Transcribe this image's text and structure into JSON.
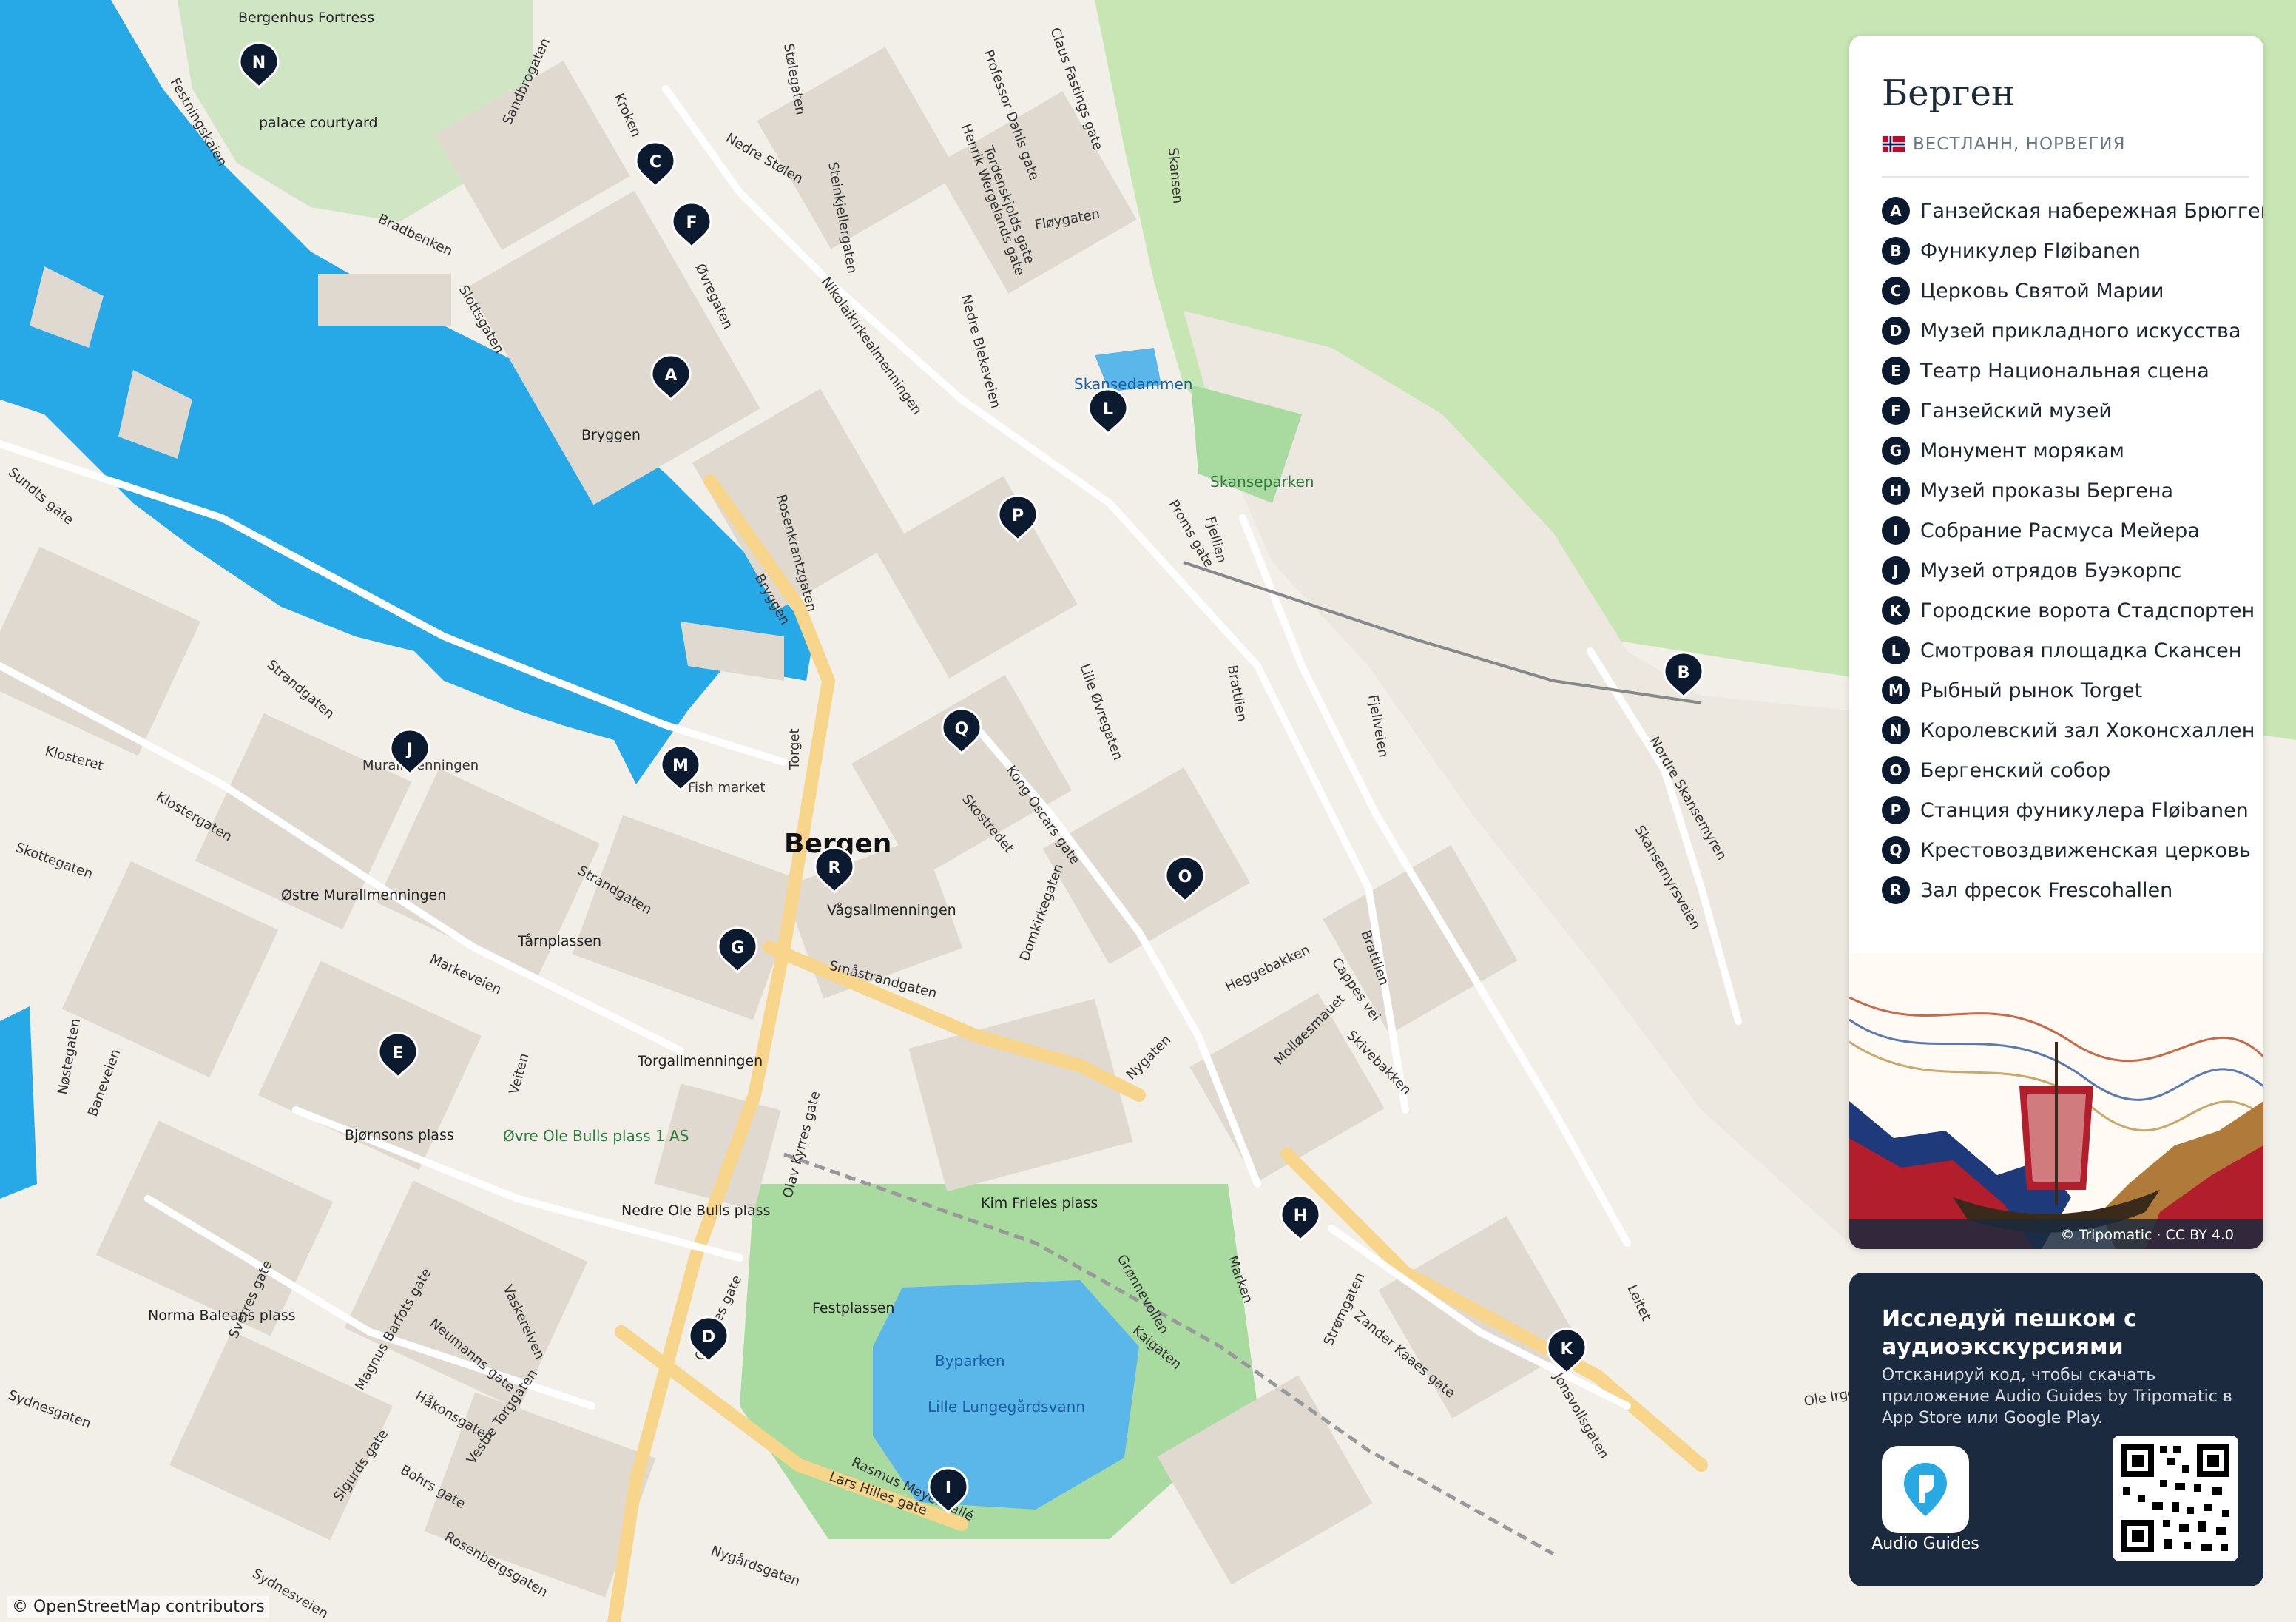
{
  "map": {
    "colors": {
      "water": "#27a9e8",
      "land": "#f2efe9",
      "block": "#e0d9cf",
      "green": "#c8e6b4",
      "park_dark": "#a9dba0",
      "road_main": "#f7d58b",
      "road": "#ffffff"
    },
    "city_label": "Bergen",
    "place_labels": [
      "Bergenhus Fortress",
      "palace courtyard",
      "Bryggen",
      "Skansedammen",
      "Skanseparken",
      "Østre Murallmenningen",
      "Tårnplassen",
      "Bjørnsons plass",
      "Øvre Ole Bulls plass 1 AS",
      "Nedre Ole Bulls plass",
      "Kim Frieles plass",
      "Festplassen",
      "Norma Baleans plass",
      "Vågsallmenningen",
      "Torgallmenningen"
    ],
    "water_labels": [
      "Byparken",
      "Lille Lungegårdsvann"
    ],
    "street_labels": [
      "Festningskaien",
      "Bradbenken",
      "Slottsgaten",
      "Sandbrogaten",
      "Kroken",
      "Øvregaten",
      "Nedre Stølen",
      "Stølegaten",
      "Steinkjellergaten",
      "Nikolaikirkealmenningen",
      "Professor Dahls gate",
      "Claus Fastings gate",
      "Henrik Wergelands gate",
      "Tordenskjolds gate",
      "Fløygaten",
      "Skansen",
      "Nedre Blekeveien",
      "Rosenkrantzgaten",
      "Proms gate",
      "Fjellien",
      "Bryggen",
      "Torget",
      "Strandgaten",
      "Klosteret",
      "Klostergaten",
      "Skottegaten",
      "Markeveien",
      "Veiten",
      "Olav Kyrres gate",
      "Småstrandgaten",
      "Kong Oscars gate",
      "Lille Øvregaten",
      "Skostredet",
      "Domkirkegaten",
      "Heggebakken",
      "Cappes vei",
      "Skivebakken",
      "Molløesmauet",
      "Nygaten",
      "Brattlien",
      "Fjellveien",
      "Nordre Skansemyren",
      "Skansemyrsveien",
      "Brattlien",
      "Grønnevollen",
      "Marken",
      "Kaigaten",
      "Strømgaten",
      "Zander Kaaes gate",
      "Jonsvollsgaten",
      "Lars Hilles gate",
      "Nygårdsgaten",
      "Christies gate",
      "Rasmus Meyers allé",
      "Sydnesgaten",
      "Magnus Barfots gate",
      "Sverres gate",
      "Neumanns gate",
      "Håkonsgaten",
      "Vaskerelven",
      "Vestre Torggaten",
      "Bohrs gate",
      "Rosenbergsgaten",
      "Sigurds gate",
      "Sydnesveien",
      "Baneveien",
      "Nøstegaten",
      "Leitet",
      "Ole Irgens vei",
      "Sundts gate",
      "Strandgaten"
    ],
    "attribution": "© OpenStreetMap contributors",
    "markers": [
      {
        "letter": "A"
      },
      {
        "letter": "B"
      },
      {
        "letter": "C"
      },
      {
        "letter": "D"
      },
      {
        "letter": "E"
      },
      {
        "letter": "F"
      },
      {
        "letter": "G"
      },
      {
        "letter": "H"
      },
      {
        "letter": "I"
      },
      {
        "letter": "J"
      },
      {
        "letter": "K"
      },
      {
        "letter": "L"
      },
      {
        "letter": "M"
      },
      {
        "letter": "N"
      },
      {
        "letter": "O"
      },
      {
        "letter": "P"
      },
      {
        "letter": "Q"
      },
      {
        "letter": "R"
      }
    ],
    "extra_labels": {
      "fish_market": "Fish market",
      "murallmenningen": "Murallmenningen"
    }
  },
  "panel": {
    "title": "Берген",
    "subtitle": "ВЕСТЛАНН, НОРВЕГИЯ",
    "flag_icon": "norway-flag-icon",
    "legend": [
      {
        "letter": "A",
        "label": "Ганзейская набережная Брюгген"
      },
      {
        "letter": "B",
        "label": "Фуникулер Fløibanen"
      },
      {
        "letter": "C",
        "label": "Церковь Святой Марии"
      },
      {
        "letter": "D",
        "label": "Музей прикладного искусства"
      },
      {
        "letter": "E",
        "label": "Театр Национальная сцена"
      },
      {
        "letter": "F",
        "label": "Ганзейский музей"
      },
      {
        "letter": "G",
        "label": "Монумент морякам"
      },
      {
        "letter": "H",
        "label": "Музей проказы Бергена"
      },
      {
        "letter": "I",
        "label": "Собрание Расмуса Мейера"
      },
      {
        "letter": "J",
        "label": "Музей отрядов Буэкорпс"
      },
      {
        "letter": "K",
        "label": "Городские ворота Стадспортен"
      },
      {
        "letter": "L",
        "label": "Смотровая площадка Скансен"
      },
      {
        "letter": "M",
        "label": "Рыбный рынок Torget"
      },
      {
        "letter": "N",
        "label": "Королевский зал Хоконсхаллен"
      },
      {
        "letter": "O",
        "label": "Бергенский собор"
      },
      {
        "letter": "P",
        "label": "Станция фуникулера Fløibanen"
      },
      {
        "letter": "Q",
        "label": "Крестовоздвиженская церковь"
      },
      {
        "letter": "R",
        "label": "Зал фресок Frescohallen"
      }
    ],
    "art_credit": "© Tripomatic · CC BY 4.0"
  },
  "audio": {
    "title": "Исследуй пешком с аудиоэкскурсиями",
    "text": "Отсканируй код, чтобы скачать приложение Audio Guides by Tripomatic в App Store или Google Play.",
    "app_label": "Audio Guides",
    "app_icon": "audio-guides-pin-icon",
    "qr_icon": "qr-code-icon"
  }
}
